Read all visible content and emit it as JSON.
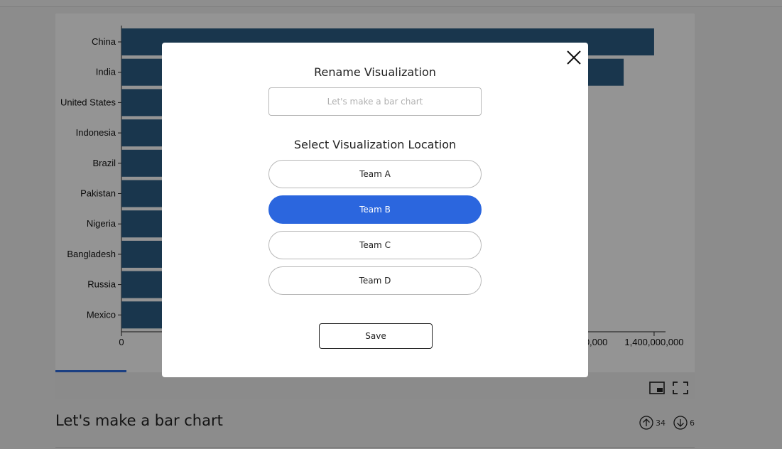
{
  "chart_data": {
    "type": "bar",
    "orientation": "horizontal",
    "categories": [
      "China",
      "India",
      "United States",
      "Indonesia",
      "Brazil",
      "Pakistan",
      "Nigeria",
      "Bangladesh",
      "Russia",
      "Mexico"
    ],
    "values": [
      1400000000,
      1320000000,
      325000000,
      265000000,
      210000000,
      200000000,
      190000000,
      165000000,
      145000000,
      125000000
    ],
    "xlim": [
      0,
      1430000000
    ],
    "x_tick_labels": [
      "0",
      "1,200,000,000",
      "1,400,000,000"
    ],
    "x_tick_label_shown": [
      "0",
      "00,000",
      "1,400,000,000"
    ],
    "x_tick_values": [
      0,
      1200000000,
      1400000000
    ],
    "bar_color": "#2b5d86",
    "grid": false
  },
  "post": {
    "title": "Let's make a bar chart",
    "upvotes": "34",
    "downvotes": "6"
  },
  "modal": {
    "rename_title": "Rename Visualization",
    "rename_placeholder": "Let's make a bar chart",
    "location_title": "Select Visualization Location",
    "options": [
      {
        "label": "Team A",
        "selected": false
      },
      {
        "label": "Team B",
        "selected": true
      },
      {
        "label": "Team C",
        "selected": false
      },
      {
        "label": "Team D",
        "selected": false
      }
    ],
    "save_label": "Save"
  },
  "colors": {
    "accent": "#2b66de",
    "progress": "#2f6de1",
    "bar": "#2b5d86"
  }
}
